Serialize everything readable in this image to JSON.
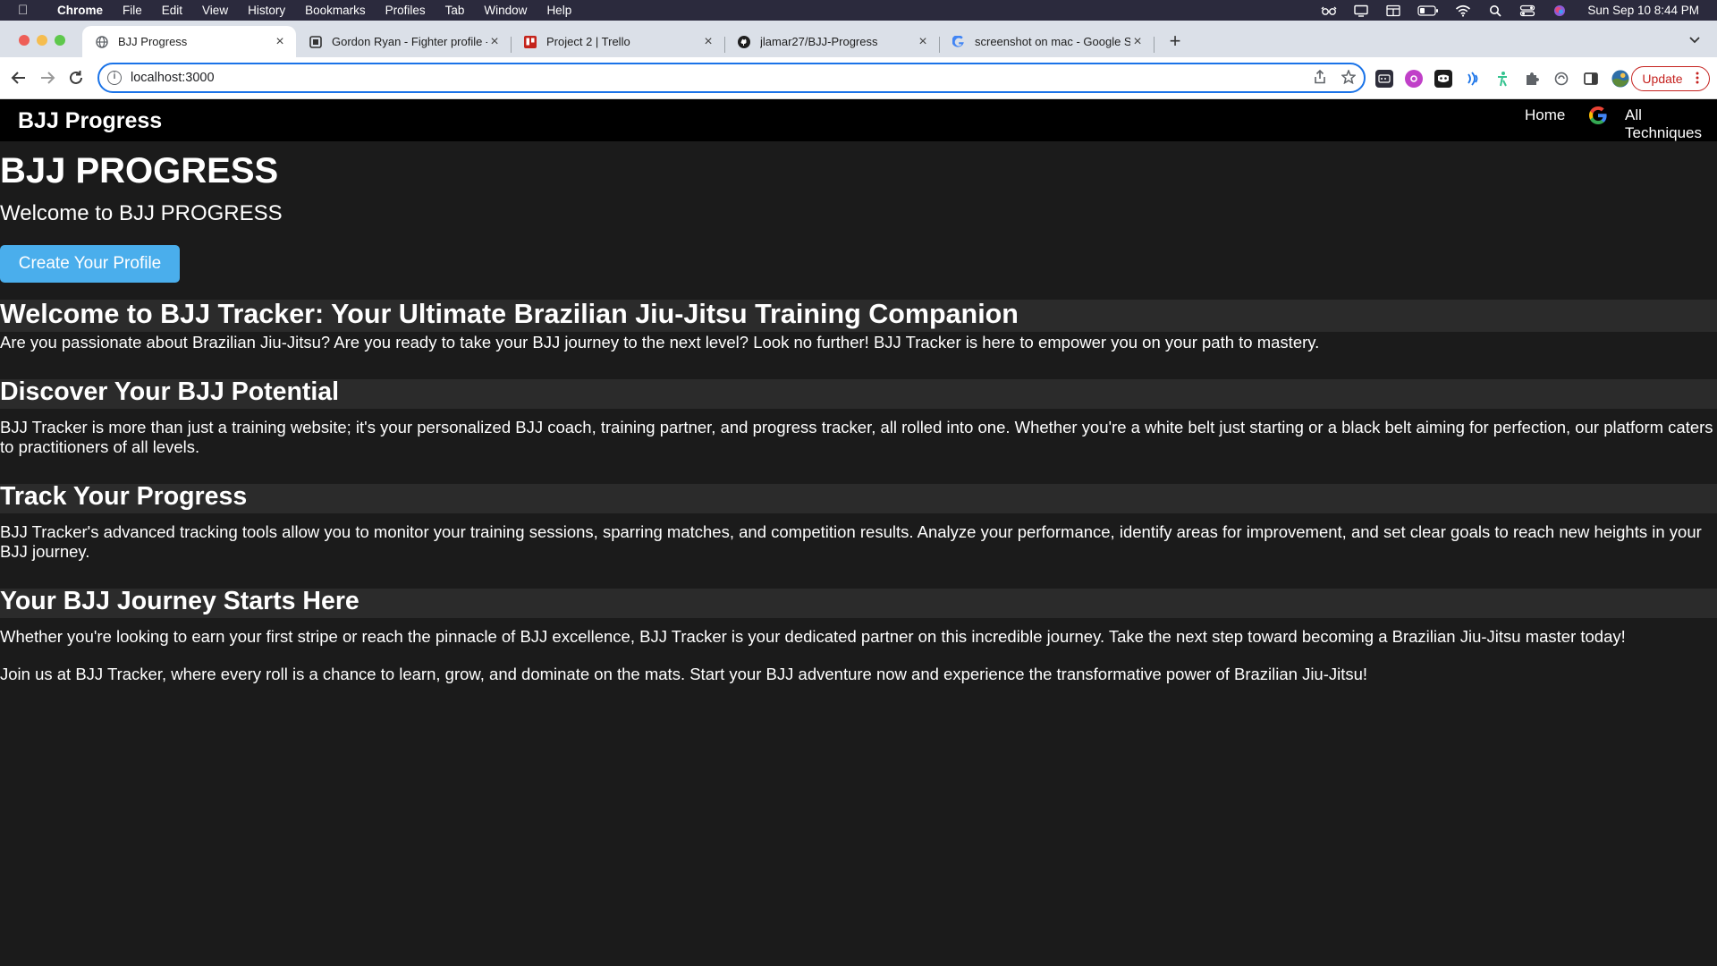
{
  "menubar": {
    "items": [
      "Chrome",
      "File",
      "Edit",
      "View",
      "History",
      "Bookmarks",
      "Profiles",
      "Tab",
      "Window",
      "Help"
    ],
    "clock": "Sun Sep 10  8:44 PM"
  },
  "tabs": [
    {
      "title": "BJJ Progress",
      "icon": "globe-icon"
    },
    {
      "title": "Gordon Ryan - Fighter profile -",
      "icon": "fighter-site-icon"
    },
    {
      "title": "Project 2 | Trello",
      "icon": "trello-icon"
    },
    {
      "title": "jlamar27/BJJ-Progress",
      "icon": "github-icon"
    },
    {
      "title": "screenshot on mac - Google Se",
      "icon": "google-icon"
    }
  ],
  "toolbar": {
    "url": "localhost:3000",
    "update_label": "Update"
  },
  "navbar": {
    "brand": "BJJ Progress",
    "links": [
      "Home",
      "All Techniques"
    ]
  },
  "hero": {
    "title": "BJJ PROGRESS",
    "subtitle": "Welcome to BJJ PROGRESS",
    "cta_label": "Create Your Profile"
  },
  "sections": [
    {
      "title": "Welcome to BJJ Tracker: Your Ultimate Brazilian Jiu-Jitsu Training Companion",
      "paragraphs": [
        "Are you passionate about Brazilian Jiu-Jitsu? Are you ready to take your BJJ journey to the next level? Look no further! BJJ Tracker is here to empower you on your path to mastery."
      ]
    },
    {
      "title": "Discover Your BJJ Potential",
      "paragraphs": [
        "BJJ Tracker is more than just a training website; it's your personalized BJJ coach, training partner, and progress tracker, all rolled into one. Whether you're a white belt just starting or a black belt aiming for perfection, our platform caters to practitioners of all levels."
      ]
    },
    {
      "title": "Track Your Progress",
      "paragraphs": [
        "BJJ Tracker's advanced tracking tools allow you to monitor your training sessions, sparring matches, and competition results. Analyze your performance, identify areas for improvement, and set clear goals to reach new heights in your BJJ journey."
      ]
    },
    {
      "title": "Your BJJ Journey Starts Here",
      "paragraphs": [
        "Whether you're looking to earn your first stripe or reach the pinnacle of BJJ excellence, BJJ Tracker is your dedicated partner on this incredible journey. Take the next step toward becoming a Brazilian Jiu-Jitsu master today!",
        "Join us at BJJ Tracker, where every roll is a chance to learn, grow, and dominate on the mats. Start your BJJ adventure now and experience the transformative power of Brazilian Jiu-Jitsu!"
      ]
    }
  ]
}
